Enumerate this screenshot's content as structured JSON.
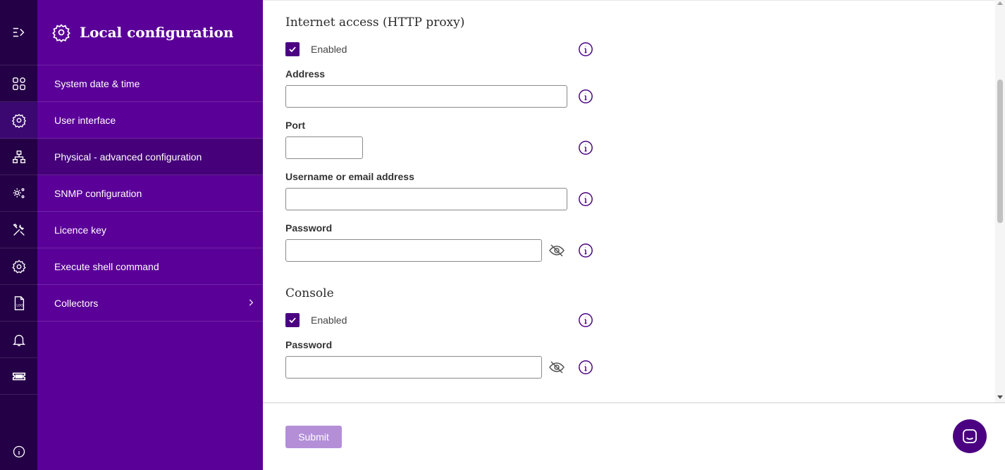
{
  "rail": {
    "items": [
      {
        "icon": "expand-menu-icon"
      },
      {
        "icon": "dashboard-grid-icon"
      },
      {
        "icon": "gear-location-icon"
      },
      {
        "icon": "network-topology-icon"
      },
      {
        "icon": "gears-icon"
      },
      {
        "icon": "tools-icon"
      },
      {
        "icon": "settings-gear-icon"
      },
      {
        "icon": "log-file-icon"
      },
      {
        "icon": "bell-icon"
      },
      {
        "icon": "ticket-icon"
      },
      {
        "icon": "info-icon"
      }
    ]
  },
  "sidebar": {
    "title": "Local configuration",
    "items": [
      {
        "label": "System date & time"
      },
      {
        "label": "User interface"
      },
      {
        "label": "Physical - advanced configuration",
        "active": true
      },
      {
        "label": "SNMP configuration"
      },
      {
        "label": "Licence key"
      },
      {
        "label": "Execute shell command"
      },
      {
        "label": "Collectors",
        "has_children": true
      }
    ]
  },
  "proxy": {
    "title": "Internet access (HTTP proxy)",
    "enabled_label": "Enabled",
    "enabled": true,
    "address_label": "Address",
    "address_value": "",
    "port_label": "Port",
    "port_value": "",
    "username_label": "Username or email address",
    "username_value": "",
    "password_label": "Password",
    "password_value": ""
  },
  "console": {
    "title": "Console",
    "enabled_label": "Enabled",
    "enabled": true,
    "password_label": "Password",
    "password_value": ""
  },
  "footer": {
    "submit_label": "Submit"
  },
  "colors": {
    "rail_bg": "#240046",
    "sidebar_bg": "#5a0098",
    "accent": "#4b0082",
    "submit_disabled": "#b48fd8"
  }
}
